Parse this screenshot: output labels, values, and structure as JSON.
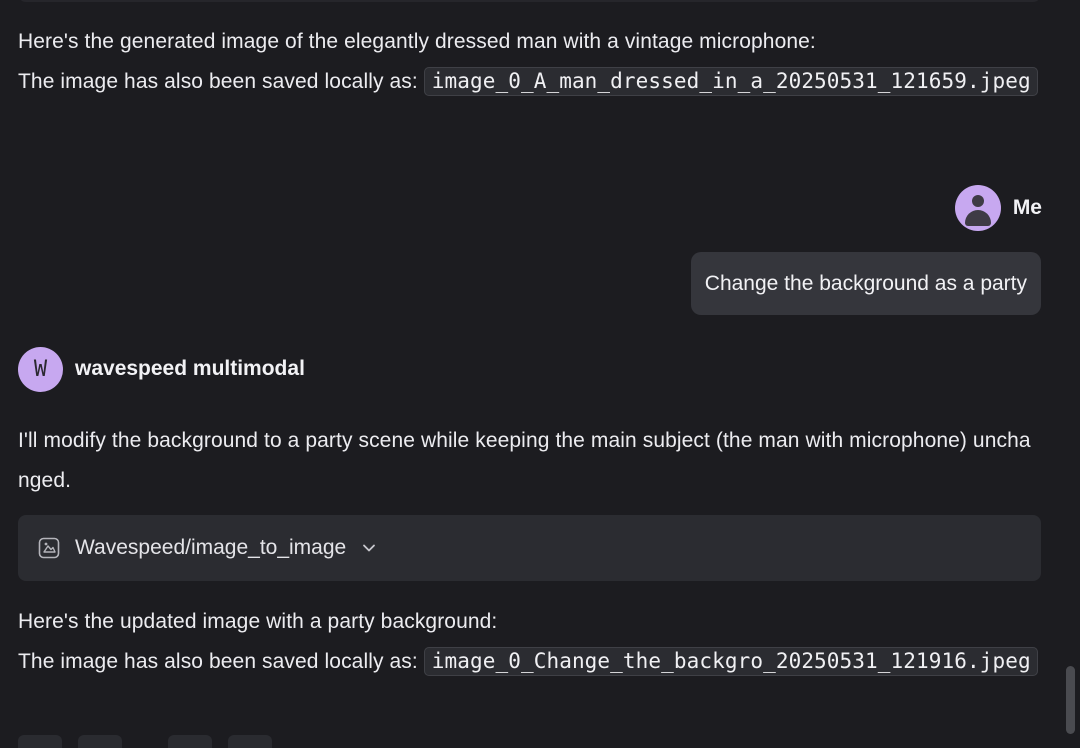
{
  "messages": {
    "bot_prev": {
      "line1": "Here's the generated image of the elegantly dressed man with a vintage microphone:",
      "saved_prefix": "The image has also been saved locally as: ",
      "filename": "image_0_A_man_dressed_in_a_20250531_121659.jpeg"
    },
    "user": {
      "name": "Me",
      "text": "Change the background as a party",
      "avatar_icon": "person-icon"
    },
    "bot": {
      "name": "wavespeed multimodal",
      "avatar_letter": "W",
      "intro": "I'll modify the background to a party scene while keeping the main subject (the man with microphone) unchanged.",
      "tool": {
        "icon": "image-tool-icon",
        "label": "Wavespeed/image_to_image",
        "expand_icon": "chevron-down-icon"
      },
      "result_line1": "Here's the updated image with a party background:",
      "saved_prefix": "The image has also been saved locally as: ",
      "filename": "image_0_Change_the_backgro_20250531_121916.jpeg"
    }
  },
  "colors": {
    "background": "#1c1c20",
    "avatar": "#c7a8f0",
    "bubble": "#35363c",
    "code_bg": "#2b2c31",
    "text": "#ececf0"
  }
}
